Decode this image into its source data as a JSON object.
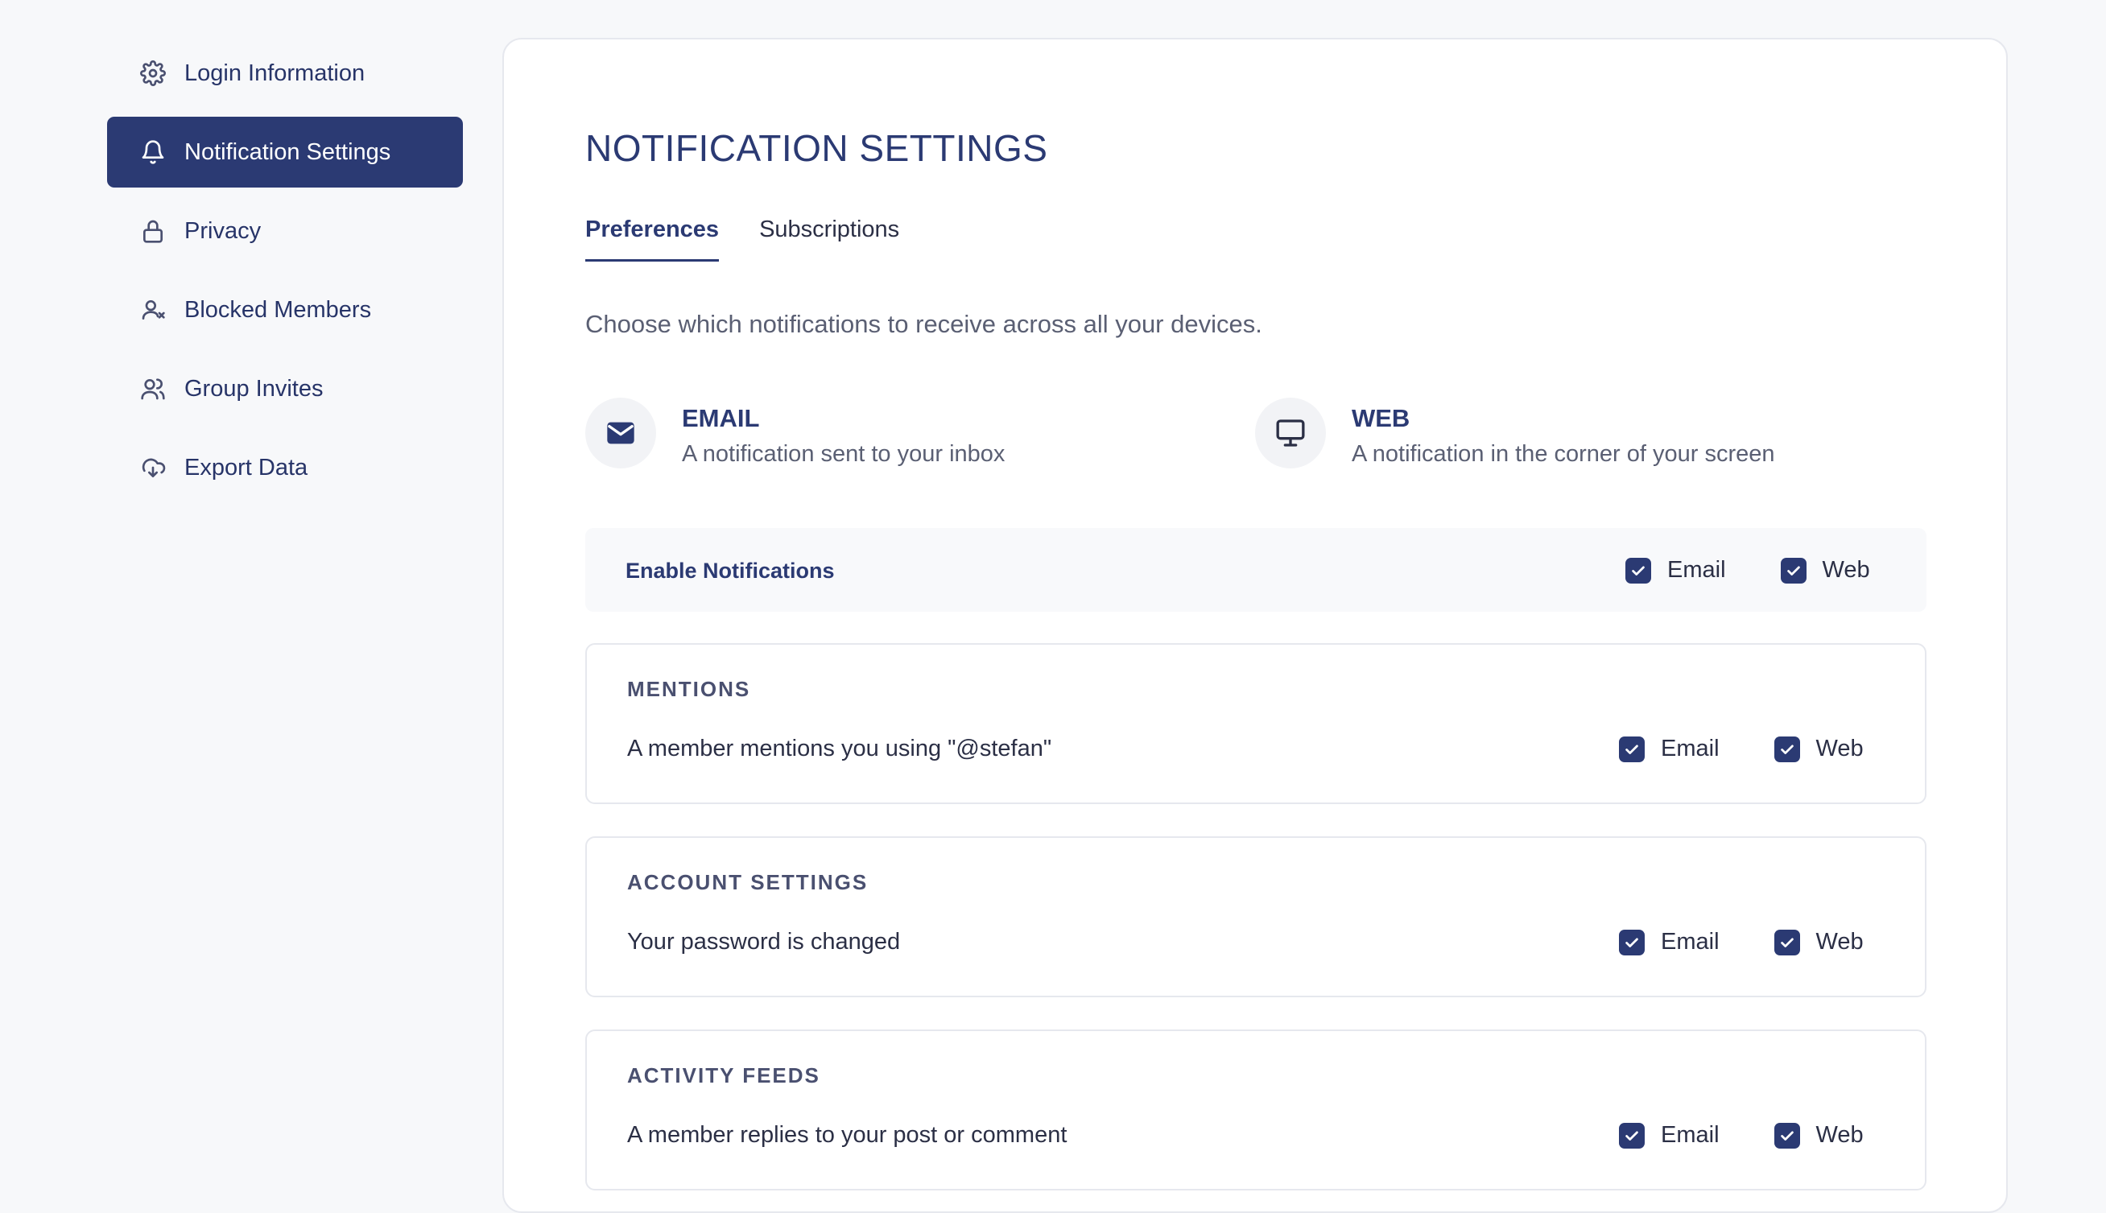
{
  "sidebar": {
    "items": [
      {
        "label": "Login Information",
        "icon": "gear-icon"
      },
      {
        "label": "Notification Settings",
        "icon": "bell-icon",
        "active": true
      },
      {
        "label": "Privacy",
        "icon": "lock-icon"
      },
      {
        "label": "Blocked Members",
        "icon": "user-blocked-icon"
      },
      {
        "label": "Group Invites",
        "icon": "users-icon"
      },
      {
        "label": "Export Data",
        "icon": "cloud-download-icon"
      }
    ]
  },
  "main": {
    "title": "NOTIFICATION SETTINGS",
    "tabs": [
      {
        "label": "Preferences",
        "active": true
      },
      {
        "label": "Subscriptions"
      }
    ],
    "intro": "Choose which notifications to receive across all your devices.",
    "channels": [
      {
        "title": "EMAIL",
        "description": "A notification sent to your inbox",
        "icon": "envelope-icon"
      },
      {
        "title": "WEB",
        "description": "A notification in the corner of your screen",
        "icon": "monitor-icon"
      }
    ],
    "enable": {
      "label": "Enable Notifications",
      "email_label": "Email",
      "web_label": "Web",
      "email_checked": true,
      "web_checked": true
    },
    "sections": [
      {
        "title": "MENTIONS",
        "description": "A member mentions you using \"@stefan\"",
        "email_label": "Email",
        "web_label": "Web",
        "email_checked": true,
        "web_checked": true
      },
      {
        "title": "ACCOUNT SETTINGS",
        "description": "Your password is changed",
        "email_label": "Email",
        "web_label": "Web",
        "email_checked": true,
        "web_checked": true
      },
      {
        "title": "ACTIVITY FEEDS",
        "description": "A member replies to your post or comment",
        "email_label": "Email",
        "web_label": "Web",
        "email_checked": true,
        "web_checked": true
      }
    ]
  },
  "colors": {
    "accent": "#2b3a73",
    "background": "#f7f8fa",
    "text": "#2b2f45",
    "muted": "#5a5f73"
  }
}
